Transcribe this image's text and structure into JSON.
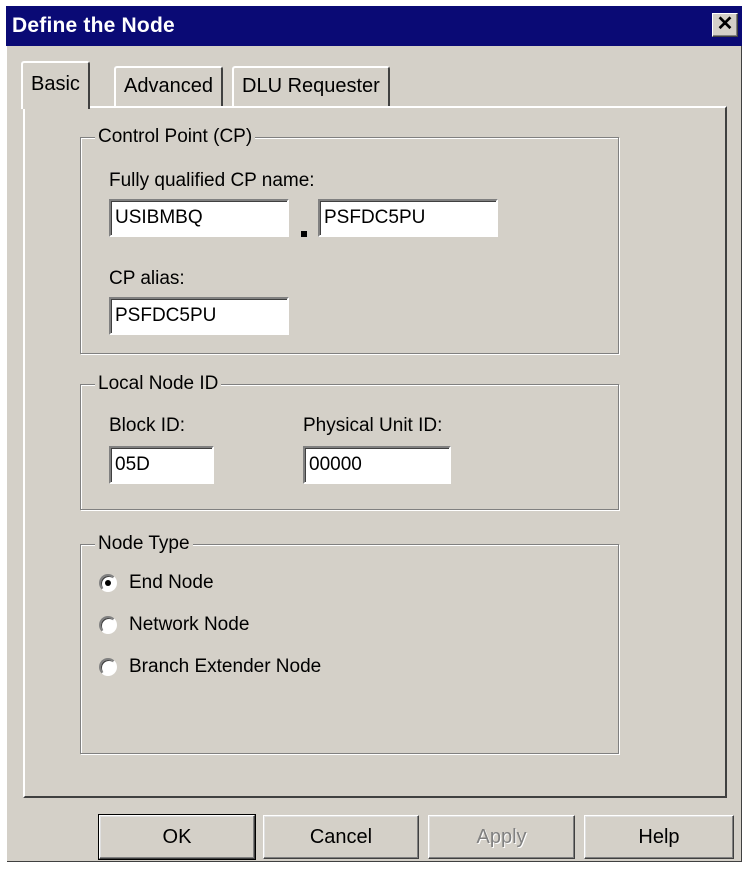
{
  "window": {
    "title": "Define the Node",
    "close_symbol": "✕"
  },
  "tabs": [
    {
      "label": "Basic",
      "active": true
    },
    {
      "label": "Advanced",
      "active": false
    },
    {
      "label": "DLU Requester",
      "active": false
    }
  ],
  "control_point": {
    "legend": "Control Point (CP)",
    "fq_name_label": "Fully qualified CP name:",
    "network_name": "USIBMBQ",
    "cp_name": "PSFDC5PU",
    "alias_label": "CP alias:",
    "alias": "PSFDC5PU"
  },
  "local_node_id": {
    "legend": "Local Node ID",
    "block_label": "Block ID:",
    "block_id": "05D",
    "pu_label": "Physical Unit ID:",
    "pu_id": "00000"
  },
  "node_type": {
    "legend": "Node Type",
    "options": [
      {
        "label": "End Node",
        "selected": true
      },
      {
        "label": "Network Node",
        "selected": false
      },
      {
        "label": "Branch Extender Node",
        "selected": false
      }
    ]
  },
  "buttons": {
    "ok": "OK",
    "cancel": "Cancel",
    "apply": "Apply",
    "help": "Help"
  }
}
